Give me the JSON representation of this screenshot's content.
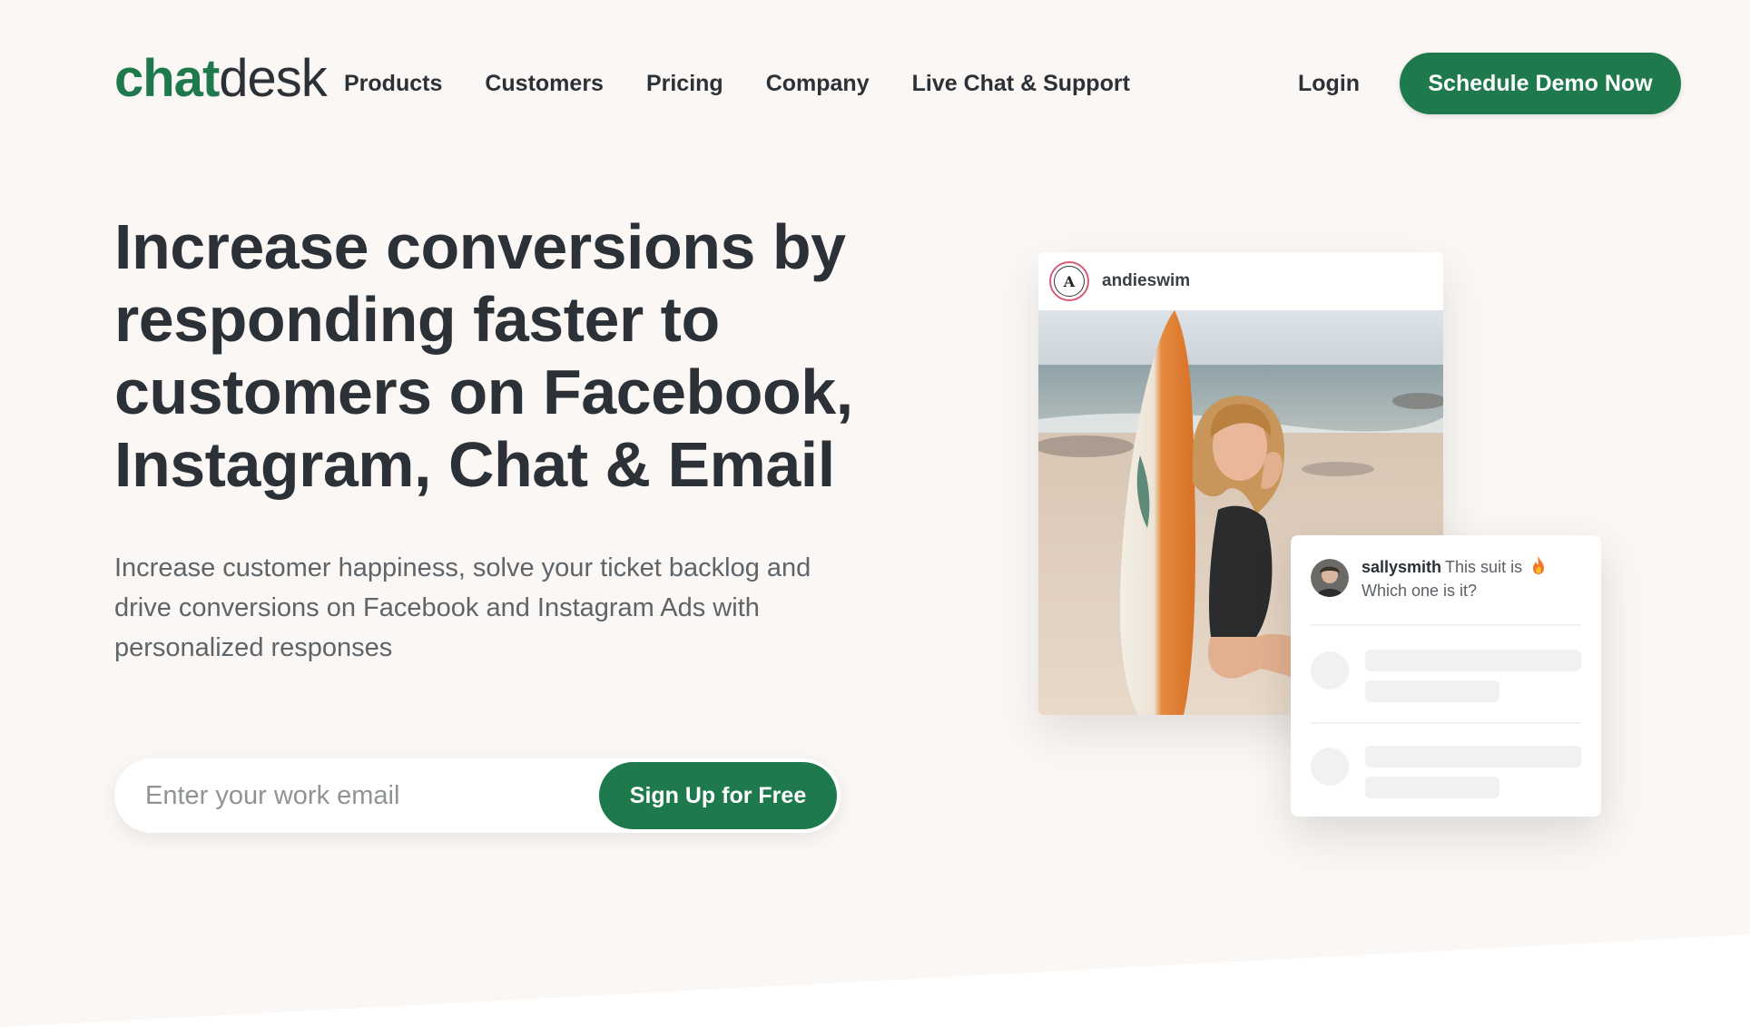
{
  "brand": {
    "logo_part1": "chat",
    "logo_part2": "desk",
    "accent_color": "#1e7a4c"
  },
  "nav": {
    "items": [
      {
        "label": "Products"
      },
      {
        "label": "Customers"
      },
      {
        "label": "Pricing"
      },
      {
        "label": "Company"
      },
      {
        "label": "Live Chat & Support"
      }
    ],
    "login_label": "Login",
    "demo_button_label": "Schedule Demo Now"
  },
  "hero": {
    "headline": "Increase conversions by responding faster to customers on Facebook, Instagram, Chat & Email",
    "subtext": "Increase customer happiness, solve your ticket backlog and drive conversions on Facebook and Instagram Ads with personalized responses",
    "email_placeholder": "Enter your work email",
    "signup_button_label": "Sign Up for Free"
  },
  "instagram_post": {
    "username": "andieswim",
    "avatar_letter": "A"
  },
  "comment": {
    "username": "sallysmith",
    "text": "This suit is",
    "icon": "fire-icon",
    "line2": "Which one is it?"
  }
}
